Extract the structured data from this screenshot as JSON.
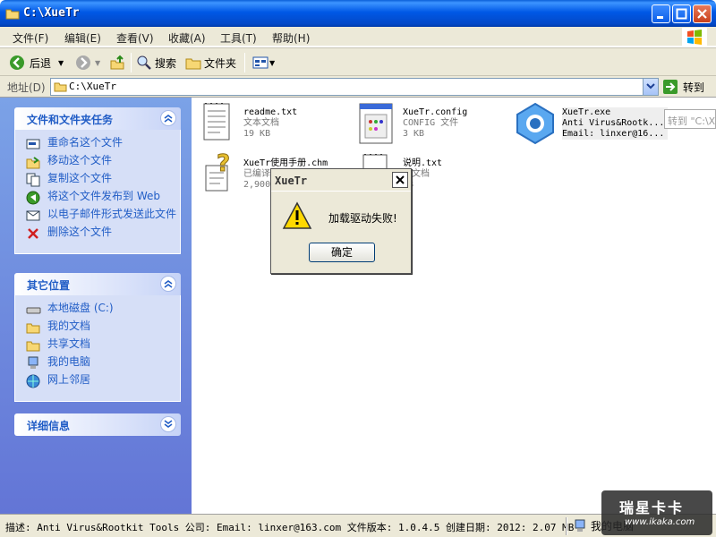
{
  "window": {
    "title": "C:\\XueTr"
  },
  "menu": [
    "文件(F)",
    "编辑(E)",
    "查看(V)",
    "收藏(A)",
    "工具(T)",
    "帮助(H)"
  ],
  "toolbar": {
    "back": "后退",
    "search": "搜索",
    "folders": "文件夹"
  },
  "address": {
    "label": "地址(D)",
    "path": "C:\\XueTr",
    "go": "转到",
    "hint": "转到 \"C:\\XueTr\""
  },
  "tasks": {
    "title": "文件和文件夹任务",
    "items": [
      "重命名这个文件",
      "移动这个文件",
      "复制这个文件",
      "将这个文件发布到 Web",
      "以电子邮件形式发送此文件",
      "删除这个文件"
    ]
  },
  "places": {
    "title": "其它位置",
    "items": [
      "本地磁盘 (C:)",
      "我的文档",
      "共享文档",
      "我的电脑",
      "网上邻居"
    ]
  },
  "details": {
    "title": "详细信息"
  },
  "files": [
    {
      "name": "readme.txt",
      "type": "文本文档",
      "size": "19 KB"
    },
    {
      "name": "XueTr.config",
      "type": "CONFIG 文件",
      "size": "3 KB"
    },
    {
      "name": "XueTr.exe",
      "type": "Anti Virus&Rootk...",
      "size": "Email: linxer@16..."
    },
    {
      "name": "XueTr使用手册.chm",
      "type": "已编译",
      "size": "2,900"
    },
    {
      "name": "说明.txt",
      "type": "本文档",
      "size": "KB"
    }
  ],
  "dialog": {
    "title": "XueTr",
    "message": "加载驱动失败!",
    "ok": "确定"
  },
  "status": {
    "text": "描述: Anti Virus&Rootkit Tools 公司: Email: linxer@163.com 文件版本: 1.0.4.5 创建日期: 2012: 2.07 MB",
    "zone": "我的电脑"
  },
  "watermark": {
    "line1": "瑞星卡卡",
    "line2": "www.ikaka.com"
  },
  "colors": {
    "titlebar": "#0058e6",
    "taskpane": "#7ba2e7",
    "link": "#215dc6"
  }
}
